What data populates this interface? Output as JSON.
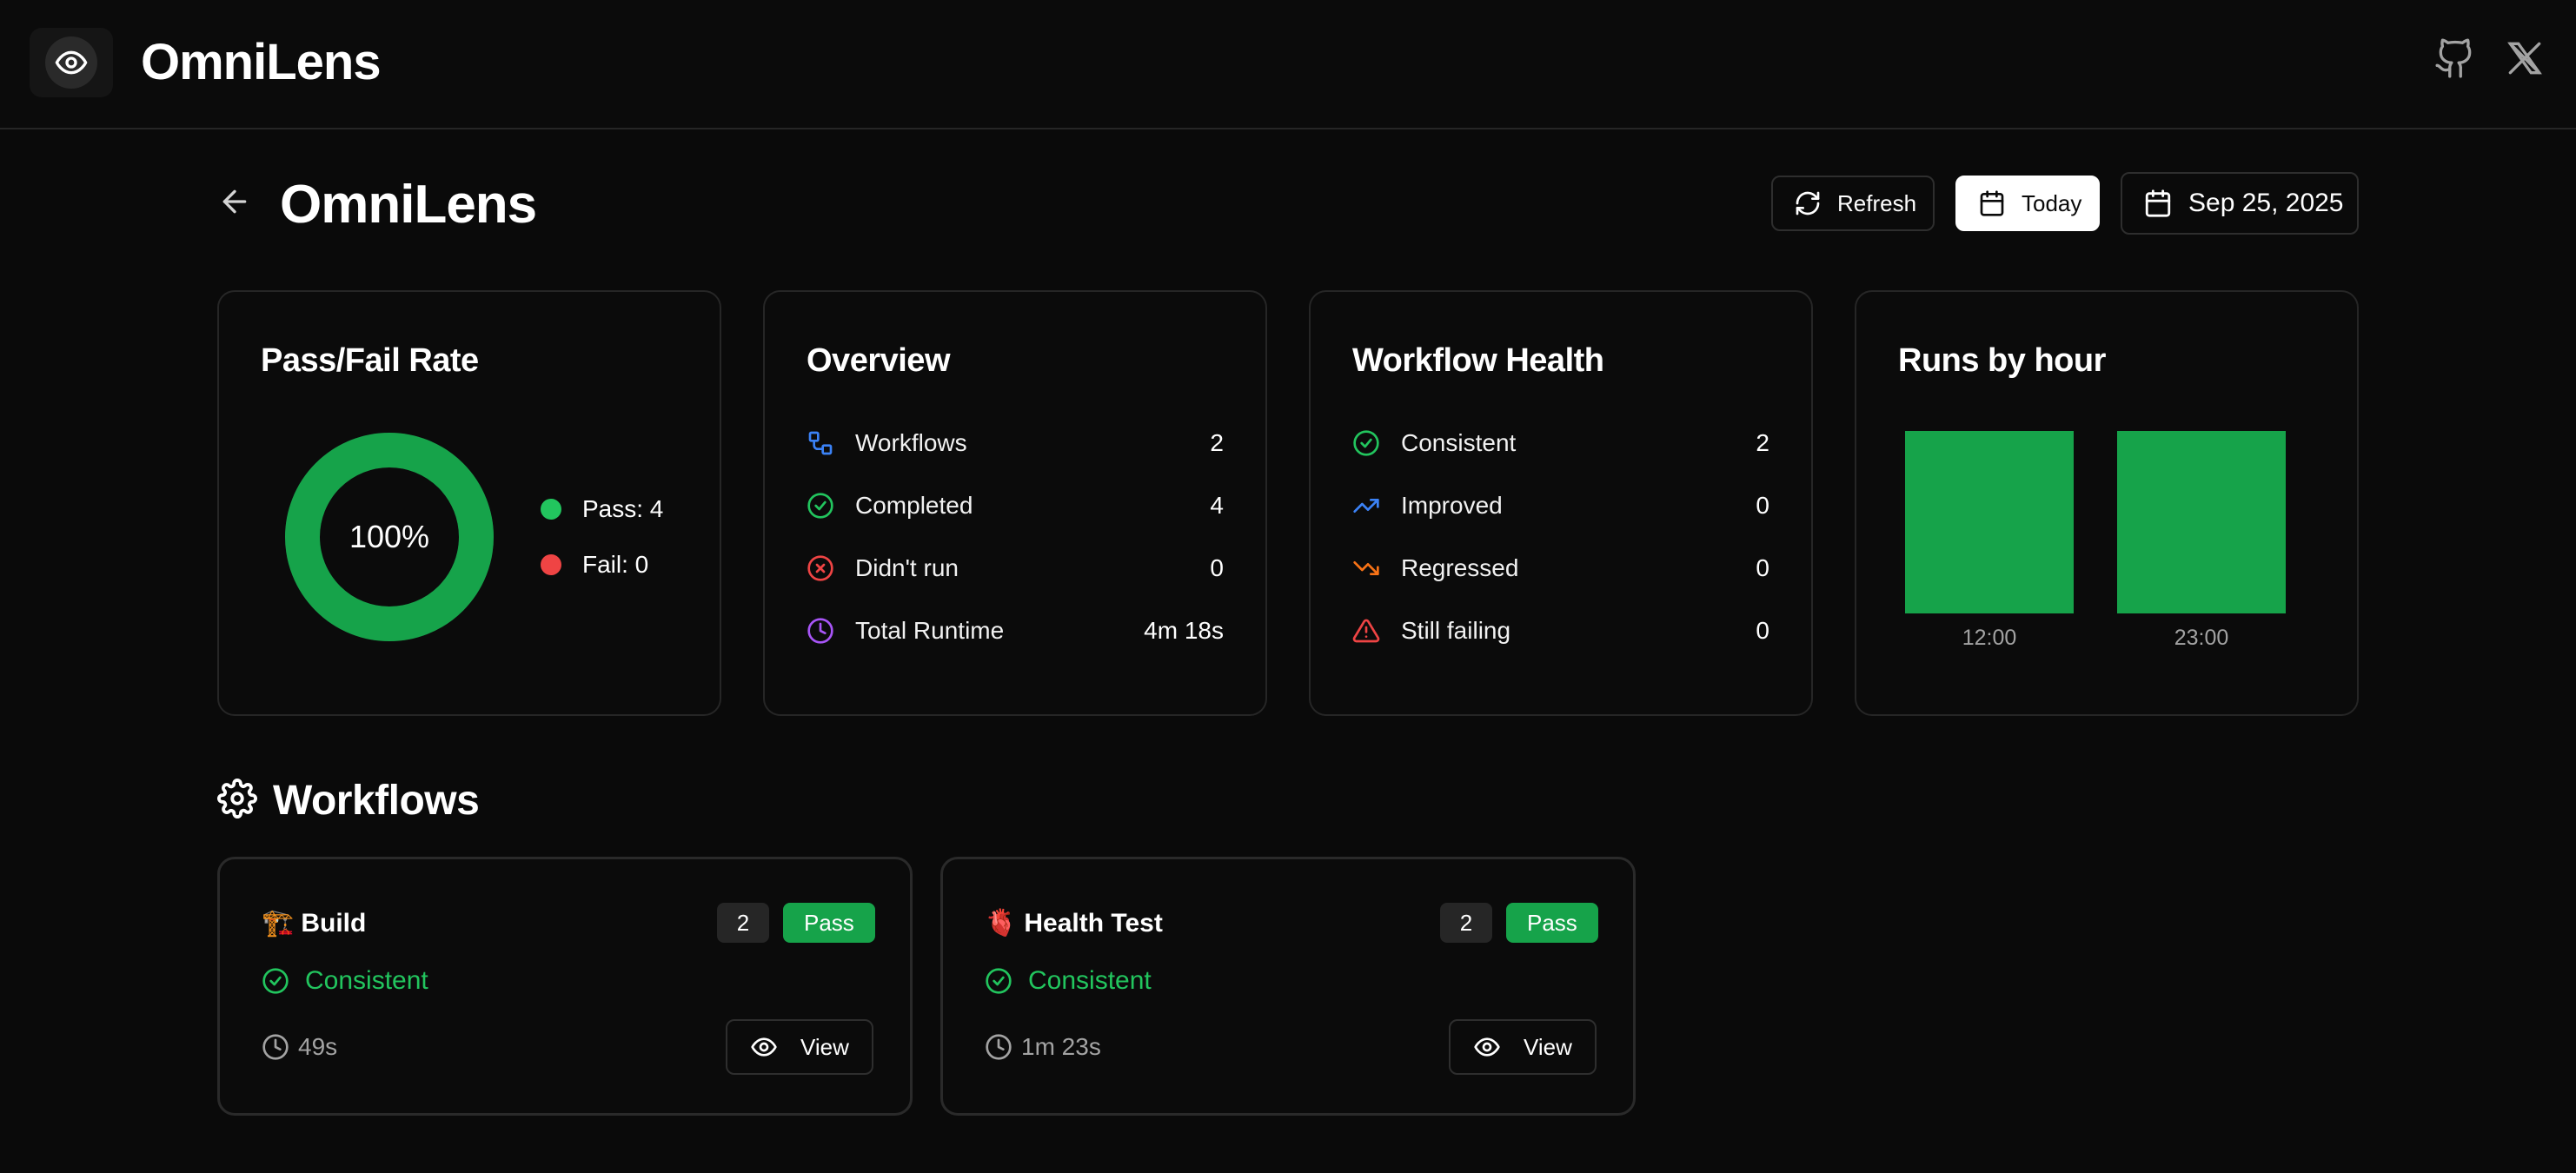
{
  "app": {
    "brand": "OmniLens"
  },
  "header": {
    "title": "OmniLens",
    "refresh_label": "Refresh",
    "today_label": "Today",
    "date_label": "Sep 25, 2025"
  },
  "pass_fail": {
    "title": "Pass/Fail Rate",
    "percent_label": "100%",
    "pass_label": "Pass: 4",
    "fail_label": "Fail: 0",
    "pass_fraction": 1.0,
    "colors": {
      "pass": "#22c55e",
      "fail": "#ef4444",
      "ring": "#16a34a"
    }
  },
  "overview": {
    "title": "Overview",
    "rows": [
      {
        "icon": "workflow-icon",
        "label": "Workflows",
        "value": "2"
      },
      {
        "icon": "check-circle-icon",
        "label": "Completed",
        "value": "4"
      },
      {
        "icon": "x-circle-icon",
        "label": "Didn't run",
        "value": "0"
      },
      {
        "icon": "clock-icon",
        "label": "Total Runtime",
        "value": "4m 18s"
      }
    ]
  },
  "health": {
    "title": "Workflow Health",
    "rows": [
      {
        "icon": "check-circle-icon",
        "label": "Consistent",
        "value": "2"
      },
      {
        "icon": "trending-up-icon",
        "label": "Improved",
        "value": "0"
      },
      {
        "icon": "trending-down-icon",
        "label": "Regressed",
        "value": "0"
      },
      {
        "icon": "warning-triangle-icon",
        "label": "Still failing",
        "value": "0"
      }
    ]
  },
  "chart_data": {
    "type": "bar",
    "title": "Runs by hour",
    "categories": [
      "12:00",
      "23:00"
    ],
    "values": [
      1,
      1
    ],
    "xlabel": "",
    "ylabel": "",
    "ylim": [
      0,
      1
    ],
    "grid": false,
    "color": "#16a34a"
  },
  "workflows_section": {
    "title": "Workflows",
    "items": [
      {
        "emoji": "🏗️",
        "name": "Build",
        "count": "2",
        "badge": "Pass",
        "status": "Consistent",
        "duration": "49s",
        "view_label": "View"
      },
      {
        "emoji": "🫀",
        "name": "Health Test",
        "count": "2",
        "badge": "Pass",
        "status": "Consistent",
        "duration": "1m 23s",
        "view_label": "View"
      }
    ]
  }
}
